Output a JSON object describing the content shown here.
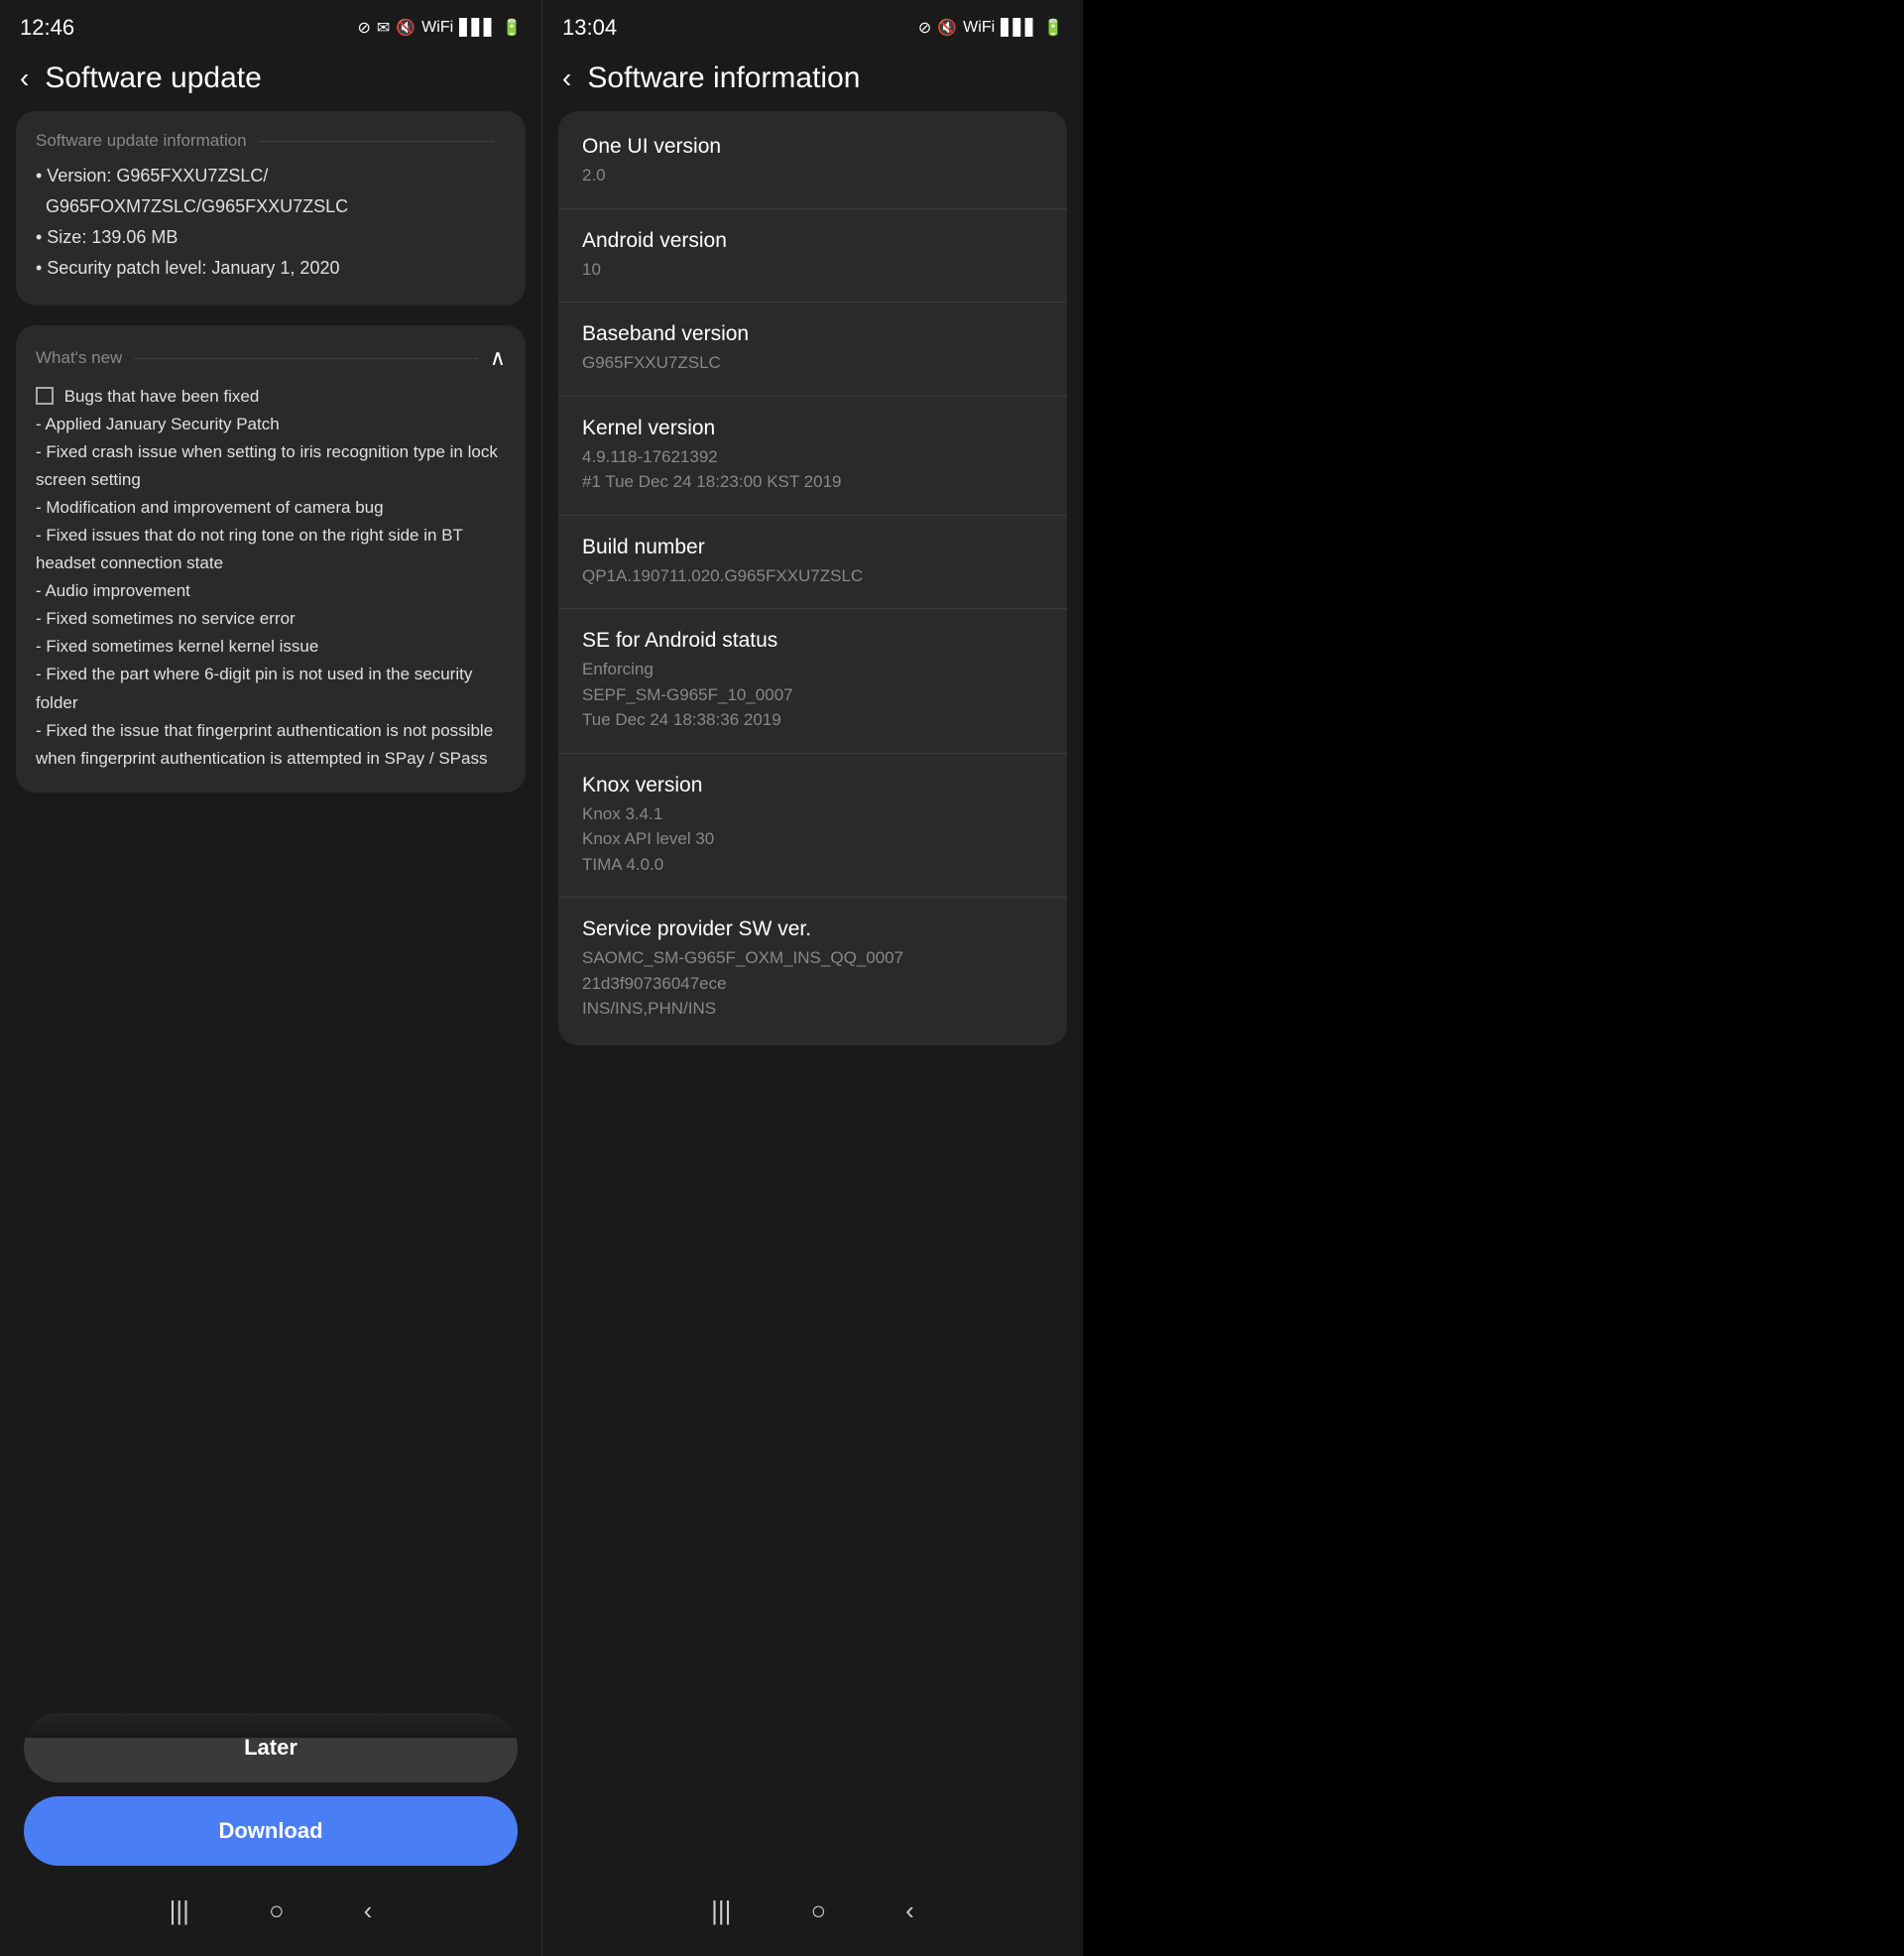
{
  "left_panel": {
    "status_bar": {
      "time": "12:46",
      "icons": [
        "block-icon",
        "mail-icon",
        "mute-icon",
        "wifi-icon",
        "signal-icon",
        "battery-icon"
      ]
    },
    "header": {
      "back_label": "‹",
      "title": "Software update"
    },
    "info_section": {
      "section_title": "Software update information",
      "items": [
        "• Version: G965FXXU7ZSLC/",
        "   G965FOXM7ZSLC/G965FXXU7ZSLC",
        "• Size: 139.06 MB",
        "• Security patch level: January 1, 2020"
      ]
    },
    "whats_new": {
      "section_title": "What's new",
      "items": [
        "□ Bugs that have been fixed",
        " - Applied January Security Patch",
        " - Fixed crash issue when setting to iris recognition type in lock screen setting",
        " - Modification and improvement of camera bug",
        " - Fixed issues that do not ring tone on the right side in BT headset connection state",
        " - Audio improvement",
        " - Fixed sometimes no service error",
        " - Fixed sometimes kernel kernel issue",
        " - Fixed the part where 6-digit pin is not used in the security folder",
        " - Fixed the issue that fingerprint authentication is not possible when fingerprint authentication is attempted in SPay / SPass"
      ]
    },
    "buttons": {
      "later": "Later",
      "download": "Download"
    },
    "nav_bar": {
      "items": [
        "|||",
        "○",
        "‹"
      ]
    }
  },
  "right_panel": {
    "status_bar": {
      "time": "13:04",
      "icons": [
        "block-icon",
        "mute-icon",
        "wifi-icon",
        "signal-icon",
        "battery-icon"
      ]
    },
    "header": {
      "back_label": "‹",
      "title": "Software information"
    },
    "info_rows": [
      {
        "label": "One UI version",
        "value": "2.0"
      },
      {
        "label": "Android version",
        "value": "10"
      },
      {
        "label": "Baseband version",
        "value": "G965FXXU7ZSLC"
      },
      {
        "label": "Kernel version",
        "value": "4.9.118-17621392\n#1 Tue Dec 24 18:23:00 KST 2019"
      },
      {
        "label": "Build number",
        "value": "QP1A.190711.020.G965FXXU7ZSLC"
      },
      {
        "label": "SE for Android status",
        "value": "Enforcing\nSEPF_SM-G965F_10_0007\nTue Dec 24 18:38:36 2019"
      },
      {
        "label": "Knox version",
        "value": "Knox 3.4.1\nKnox API level 30\nTIMA 4.0.0"
      },
      {
        "label": "Service provider SW ver.",
        "value": "SAOMC_SM-G965F_OXM_INS_QQ_0007\n21d3f90736047ece\nINS/INS,PHN/INS"
      }
    ],
    "nav_bar": {
      "items": [
        "|||",
        "○",
        "‹"
      ]
    }
  }
}
